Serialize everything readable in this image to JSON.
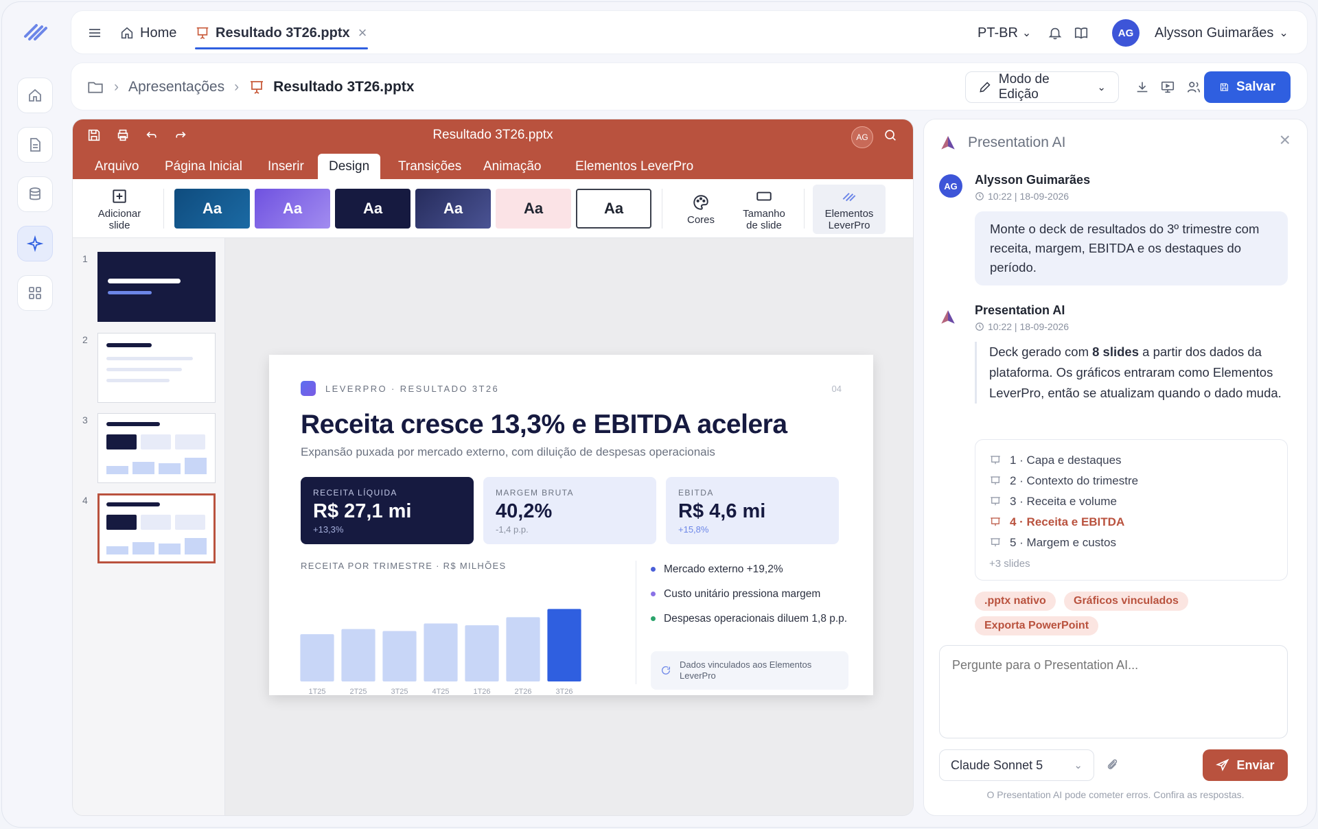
{
  "nav": {
    "home": "Home",
    "file_tab": "Resultado 3T26.pptx",
    "close": "×",
    "lang": "PT-BR",
    "lang_chevron": "⌄",
    "user_initials": "AG",
    "user_name": "Alysson Guimarães",
    "user_chevron": "⌄"
  },
  "crumbs": {
    "sep": "›",
    "folder": "Apresentações",
    "file": "Resultado 3T26.pptx"
  },
  "actions": {
    "edit_mode": "Modo de Edição",
    "edit_chevron": "⌄",
    "save": "Salvar"
  },
  "editor": {
    "title": "Resultado 3T26.pptx",
    "avatar": "AG",
    "tabs": [
      "Arquivo",
      "Página Inicial",
      "Inserir",
      "Design",
      "Transições",
      "Animação",
      "Elementos LeverPro"
    ],
    "ribbon": {
      "add_slide_1": "Adicionar",
      "add_slide_2": "slide",
      "theme_label": "Aa",
      "colors": "Cores",
      "size_1": "Tamanho",
      "size_2": "de slide",
      "elements_1": "Elementos",
      "elements_2": "LeverPro"
    },
    "thumb_numbers": [
      "1",
      "2",
      "3",
      "4"
    ]
  },
  "slide": {
    "kicker": "LEVERPRO · RESULTADO 3T26",
    "page": "04",
    "title": "Receita cresce 13,3% e EBITDA acelera",
    "subtitle": "Expansão puxada por mercado externo, com diluição de despesas operacionais",
    "kpis": [
      {
        "label": "RECEITA LÍQUIDA",
        "value": "R$ 27,1 mi",
        "delta": "+13,3%"
      },
      {
        "label": "MARGEM BRUTA",
        "value": "40,2%",
        "delta": "-1,4 p.p."
      },
      {
        "label": "EBITDA",
        "value": "R$ 4,6 mi",
        "delta": "+15,8%"
      }
    ],
    "bullets": [
      "Mercado externo +19,2%",
      "Custo unitário pressiona margem",
      "Despesas operacionais diluem 1,8 p.p."
    ],
    "linked_note": "Dados vinculados aos Elementos LeverPro",
    "colors": {
      "dark": "#161a40",
      "bar": "#c8d6f7",
      "bar_highlight": "#2f5fe0"
    }
  },
  "chart_data": {
    "type": "bar",
    "title": "RECEITA POR TRIMESTRE · R$ MILHÕES",
    "categories": [
      "1T25",
      "2T25",
      "3T25",
      "4T25",
      "1T26",
      "2T26",
      "3T26"
    ],
    "values": [
      21.2,
      23.5,
      22.6,
      26.0,
      25.2,
      28.8,
      32.5
    ],
    "ylim": [
      0,
      40
    ],
    "highlight_index": 6,
    "grid": false
  },
  "panel": {
    "title": "Presentation AI",
    "close": "×",
    "user_name": "Alysson Guimarães",
    "user_initials": "AG",
    "user_meta": "10:22 | 18-09-2026",
    "user_msg": "Monte o deck de resultados do 3º trimestre com receita, margem, EBITDA e os destaques do período.",
    "ai_name": "Presentation AI",
    "ai_meta": "10:22 | 18-09-2026",
    "ai_msg_pre": "Deck gerado com ",
    "ai_msg_bold": "8 slides",
    "ai_msg_post": " a partir dos dados da plataforma. Os gráficos entraram como Elementos LeverPro, então se atualizam quando o dado muda.",
    "slides": [
      "1 · Capa e destaques",
      "2 · Contexto do trimestre",
      "3 · Receita e volume",
      "4 · Receita e EBITDA",
      "5 · Margem e custos"
    ],
    "more": "+3 slides",
    "chips": [
      ".pptx nativo",
      "Gráficos vinculados",
      "Exporta PowerPoint"
    ],
    "placeholder": "Pergunte para o Presentation AI...",
    "model": "Claude Sonnet 5",
    "model_chevron": "⌄",
    "send": "Enviar",
    "disclaimer": "O Presentation AI pode cometer erros. Confira as respostas.",
    "accent": "#b9523e"
  }
}
